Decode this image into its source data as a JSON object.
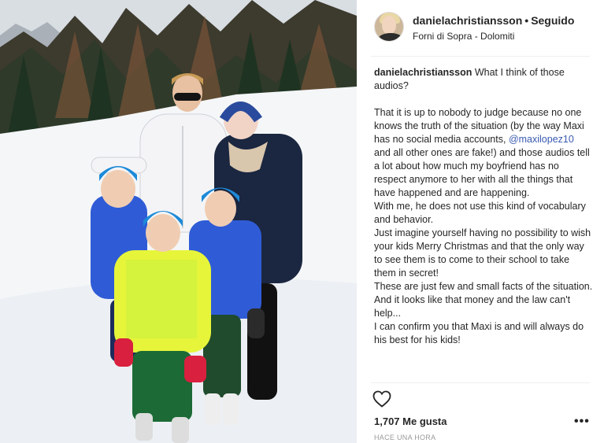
{
  "post": {
    "username": "danielachristiansson",
    "separator": "•",
    "follow_label": "Seguido",
    "location": "Forni di Sopra - Dolomiti",
    "caption_author": "danielachristiansson",
    "caption_intro": "What I think of those audios?",
    "caption_p1_a": "That it is up to nobody to judge because no one knows the truth of the situation (by the way Maxi has no social media accounts,",
    "caption_mention": "@maxilopez10",
    "caption_p1_b": "and all other ones are fake!) and those audios tell a lot about how much my boyfriend has no respect anymore to her with all the things that have happened and are happening.",
    "caption_p2": "With me, he does not use this kind of vocabulary and behavior.",
    "caption_p3": "Just imagine yourself having no possibility to wish your kids Merry Christmas and that the only way to see them is to come to their school to take them in secret!",
    "caption_p4": "These are just few and small facts of the situation. And it looks like that money and the law can't help...",
    "caption_p5": "I can confirm you that Maxi is and will always do his best for his kids!",
    "likes": "1,707 Me gusta",
    "timestamp": "HACE UNA HORA",
    "more_label": "•••"
  },
  "icons": {
    "like": "heart-outline-icon",
    "more": "more-options-icon"
  },
  "colors": {
    "mention": "#3a5ab1",
    "text": "#262626",
    "muted": "#999999"
  }
}
